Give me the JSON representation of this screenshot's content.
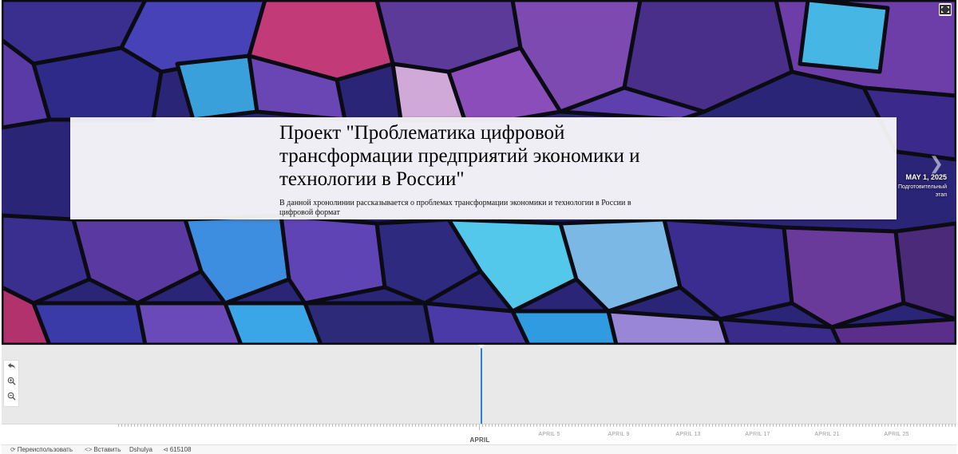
{
  "slide": {
    "title": "Проект \"Проблематика цифровой трансформации предприятий экономики и технологии в России\"",
    "description": "В данной хронолинии рассказывается о проблемах трансформации экономики и технологии в России в цифровой формат"
  },
  "next_event": {
    "date": "MAY 1, 2025",
    "caption": "Подготовительный этап"
  },
  "axis": {
    "major_label": "APRIL",
    "minor_labels": [
      "APRIL 5",
      "APRIL 9",
      "APRIL 13",
      "APRIL 17",
      "APRIL 21",
      "APRIL 25"
    ]
  },
  "footer": {
    "reuse_label": "Переиспользовать",
    "embed_label": "Вставить",
    "author": "Dshulya",
    "share_count": "615108"
  },
  "icons": {
    "fullscreen": "fullscreen-icon",
    "back": "back-arrow-icon",
    "zoom_in": "zoom-in-icon",
    "zoom_out": "zoom-out-icon",
    "next": "chevron-right-icon",
    "reuse": "refresh-icon",
    "embed": "code-icon",
    "share": "share-icon"
  },
  "colors": {
    "marker": "#2a7fd6",
    "timenav_bg": "#e9e9e9"
  }
}
